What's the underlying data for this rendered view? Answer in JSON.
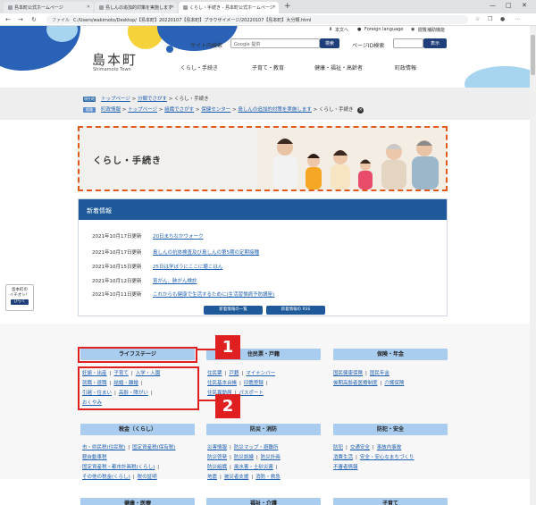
{
  "browser": {
    "tabs": [
      {
        "label": "島本町公式ホームページ"
      },
      {
        "label": "島しんの追加的対策を実施します"
      },
      {
        "label": "くらし・手続き - 島本町公式ホームページ"
      }
    ],
    "new_tab": "+",
    "url_label": "ファイル",
    "url": "C:/Users/wakimoto/Desktop/【島本町】20220107【島本町】プラウザイメージ/20220107【島本町】大分類.html",
    "nav_back": "←",
    "nav_forward": "→",
    "nav_reload": "↻",
    "icons": [
      "star-icon",
      "collections-icon",
      "profile-icon",
      "menu-icon"
    ],
    "window_buttons": {
      "minimize": "—",
      "maximize": "□",
      "close": "✕"
    }
  },
  "header": {
    "logo_name": "島本町",
    "logo_sub": "Shimamoto Town",
    "top_links": {
      "text_size": "本文へ",
      "foreign": "Foreign language",
      "accessibility": "閲覧補助機能"
    },
    "site_search_label": "サイト内検索",
    "site_search_placeholder": "Google 提供",
    "search_button": "検索",
    "page_id_label": "ページID検索",
    "page_id_button": "表示",
    "gnav": [
      "くらし・手続き",
      "子育て・教育",
      "健康・福祉・高齢者",
      "町政情報"
    ]
  },
  "breadcrumbs": {
    "tag1": "現在地",
    "line1": [
      "トップページ",
      "分類でさがす",
      "くらし・手続き"
    ],
    "tag2": "経路",
    "line2": [
      "町政情報",
      "トップページ",
      "組織でさがす",
      "保健センター",
      "島しんの追加的対策を実施します",
      "くらし・手続き"
    ],
    "sep": ">",
    "close": "×"
  },
  "hero": {
    "title": "くらし・手続き"
  },
  "news": {
    "heading": "新着情報",
    "items": [
      {
        "date": "2021年10月17日更新",
        "title": "20日まちなかウォーク"
      },
      {
        "date": "2021年10月17日更新",
        "title": "島しんの抗体検査及び島しんの第5期の定期接種"
      },
      {
        "date": "2021年10月15日更新",
        "title": "25日は学ぼうにここに聴こはん"
      },
      {
        "date": "2021年10月12日更新",
        "title": "育がん、肺がん検診"
      },
      {
        "date": "2021年10月11日更新",
        "title": "これからも健康で生活するために(生活習慣病予防講座)"
      }
    ],
    "list_button": "新着情報の一覧",
    "rss_button": "新着情報の RSS"
  },
  "side_badge": {
    "line1": "島本町の",
    "line2": "イチオシ！",
    "button": "ひらく"
  },
  "categories": [
    {
      "name": "ライフステージ",
      "links": [
        "妊娠・出産",
        "子育て",
        "入学・入園",
        "就職・退職",
        "結婚・離婚",
        "引越・住まい",
        "高齢・障がい",
        "おくやみ"
      ]
    },
    {
      "name": "住民票・戸籍",
      "links": [
        "住民票",
        "戸籍",
        "マイナンバー",
        "住民基本台帳",
        "印鑑登録",
        "住民異動届",
        "パスポート"
      ]
    },
    {
      "name": "保険・年金",
      "links": [
        "国民健康保険",
        "国民年金",
        "後期高齢者医療制度",
        "介護保険"
      ]
    },
    {
      "name": "税金（くらし）",
      "links": [
        "市・県民税(住民税)",
        "固定資産税(保有税)",
        "軽自動車税",
        "固定資産税・都市計画税(くらし)",
        "その他の税金(くらし)",
        "税の証明"
      ]
    },
    {
      "name": "防災・消防",
      "links": [
        "災害情報",
        "防災マップ・避難所",
        "防災啓発",
        "防災訓練",
        "防災計画",
        "防災組織",
        "風水害・土砂災害",
        "地震",
        "被災者支援",
        "消防・救急"
      ]
    },
    {
      "name": "防犯・安全",
      "links": [
        "防犯",
        "交通安全",
        "事故内事故",
        "消費生活",
        "安全・安心なまちづくり",
        "不審者情報"
      ]
    },
    {
      "name": "健康・医療"
    },
    {
      "name": "福祉・介護"
    },
    {
      "name": "子育て"
    }
  ],
  "annotations": {
    "label1": "1",
    "label2": "2"
  },
  "colors": {
    "accent_blue": "#1e5a99",
    "navy": "#1e3f7a",
    "category_blue": "#a9ccef",
    "annotation_red": "#e02020",
    "hero_border": "#e05a1c"
  }
}
